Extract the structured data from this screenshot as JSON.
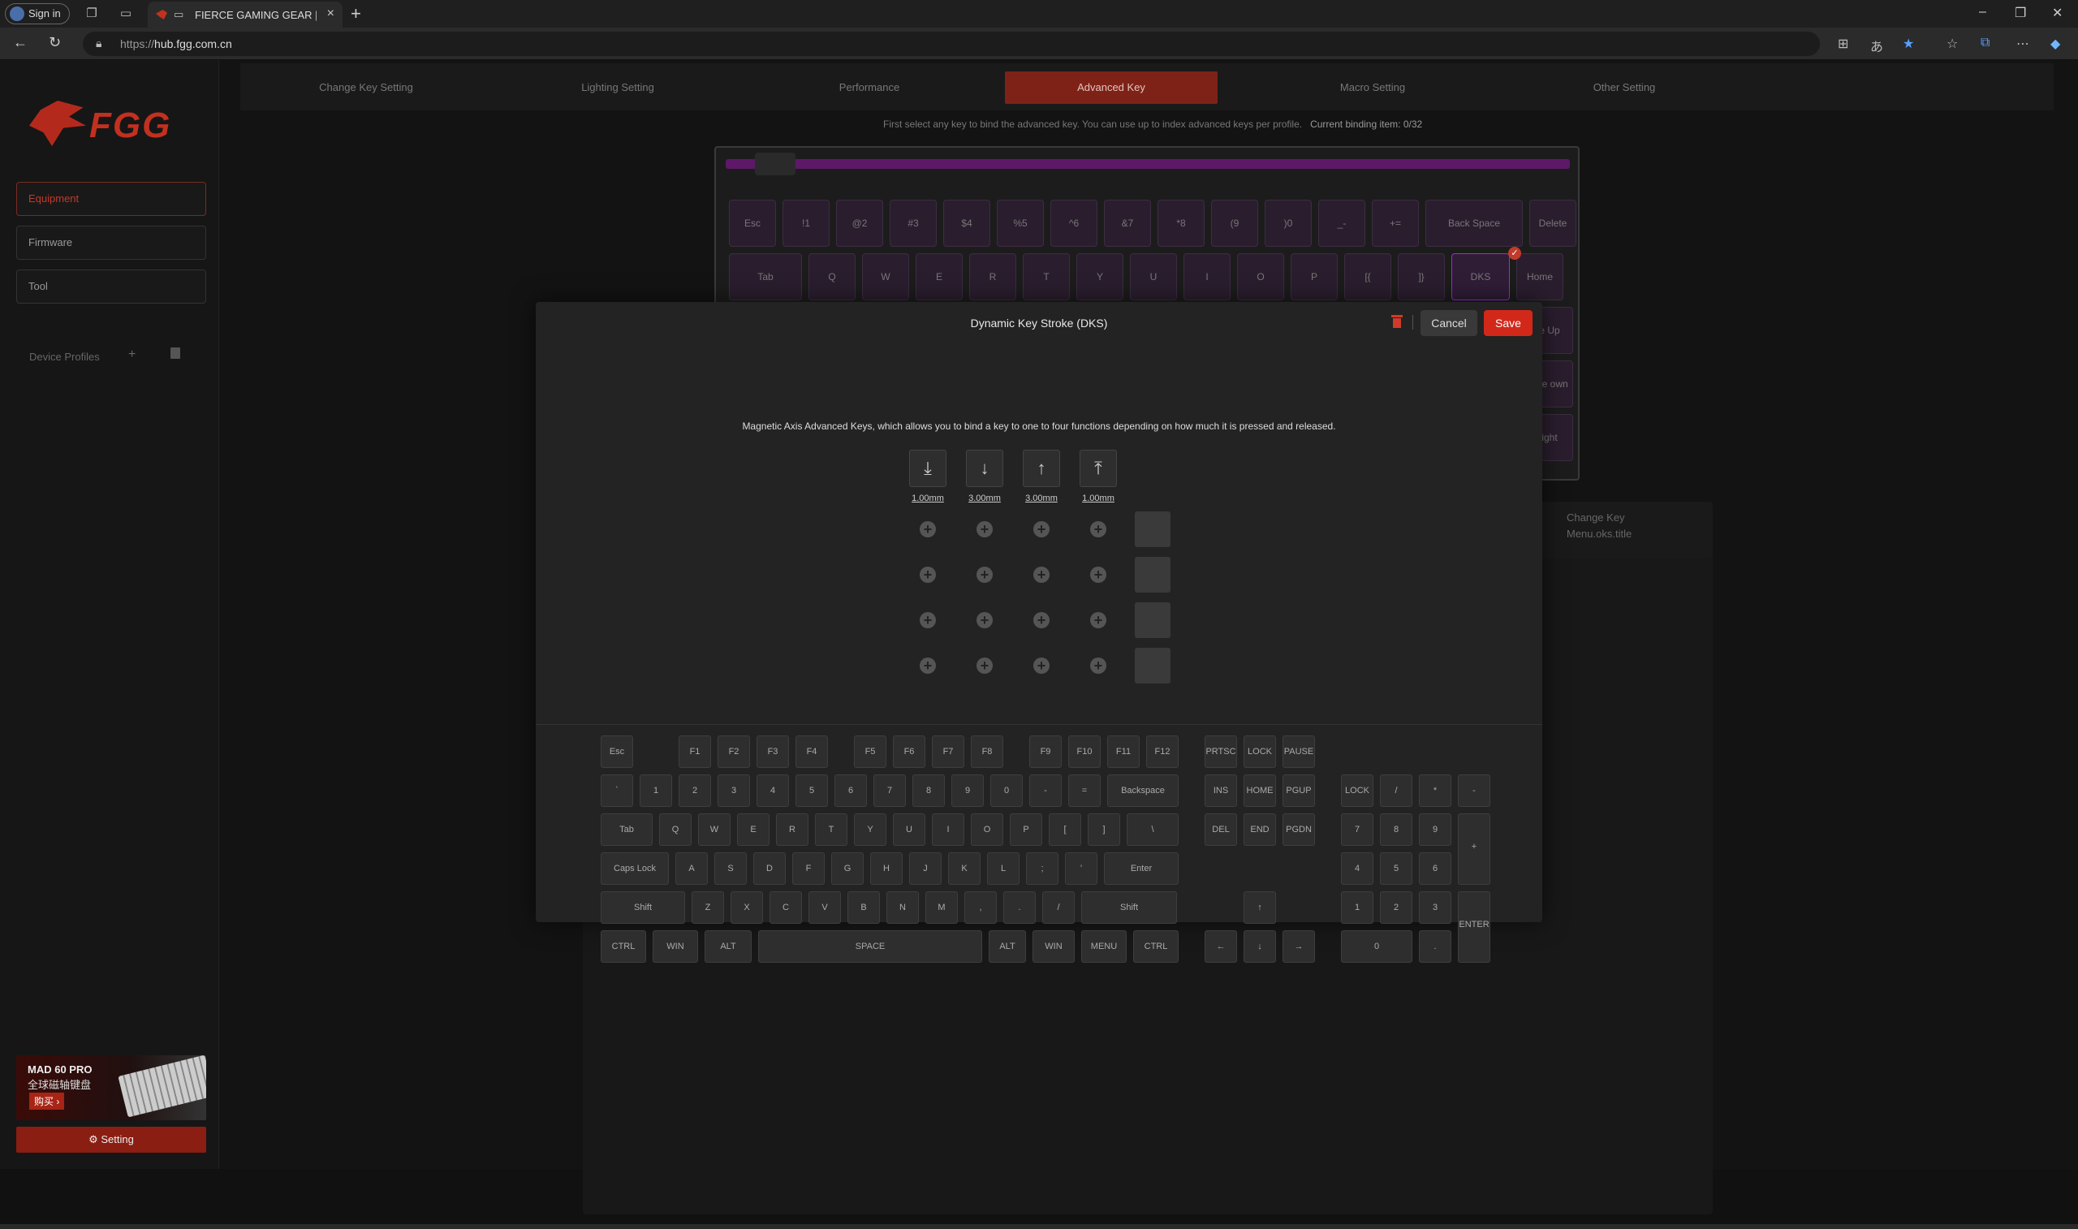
{
  "browser": {
    "signin_label": "Sign in",
    "tab_title": "FIERCE GAMING GEAR | MA",
    "url_prefix": "https://",
    "url_host": "hub.fgg.com.cn"
  },
  "sidebar": {
    "logo_text": "FGG",
    "items": [
      {
        "label": "Equipment"
      },
      {
        "label": "Firmware"
      },
      {
        "label": "Tool"
      }
    ],
    "profiles_label": "Device Profiles",
    "profiles_add": "+",
    "banner": {
      "line1": "MAD 60 PRO",
      "line2": "全球磁轴键盘",
      "cta": "购买 ›"
    },
    "setting_label": "Setting"
  },
  "topnav": [
    {
      "label": "Change Key Setting"
    },
    {
      "label": "Lighting Setting"
    },
    {
      "label": "Performance"
    },
    {
      "label": "Advanced Key"
    },
    {
      "label": "Macro Setting"
    },
    {
      "label": "Other Setting"
    }
  ],
  "hint": {
    "text": "First select any key to bind the advanced key. You can use up to index advanced keys per profile.",
    "binding": "Current binding item: 0/32"
  },
  "bg_keyboard": {
    "row1": [
      "Esc",
      "!1",
      "@2",
      "#3",
      "$4",
      "%5",
      "^6",
      "&7",
      "*8",
      "(9",
      ")0",
      "_-",
      "+=",
      "Back Space",
      "Delete"
    ],
    "row2": [
      "Tab",
      "Q",
      "W",
      "E",
      "R",
      "T",
      "Y",
      "U",
      "I",
      "O",
      "P",
      "[{",
      "]}",
      "DKS",
      "Home"
    ],
    "side": [
      "e Up",
      "age own",
      "ight"
    ]
  },
  "bg_panel": {
    "line1": "Change Key",
    "line2": "Menu.oks.title"
  },
  "modal": {
    "title": "Dynamic Key Stroke (DKS)",
    "cancel_label": "Cancel",
    "save_label": "Save",
    "description": "Magnetic Axis Advanced Keys, which allows you to bind a key to one to four functions depending on how much it is pressed and released.",
    "stages": [
      {
        "icon": "press-start-icon",
        "glyph": "⤓",
        "value": "1.00mm"
      },
      {
        "icon": "press-bottom-icon",
        "glyph": "↓",
        "value": "3.00mm"
      },
      {
        "icon": "release-start-icon",
        "glyph": "↑",
        "value": "3.00mm"
      },
      {
        "icon": "release-top-icon",
        "glyph": "⤒",
        "value": "1.00mm"
      }
    ],
    "plus_glyph": "+"
  },
  "virtual_keyboard": {
    "fn_row": [
      "Esc",
      "F1",
      "F2",
      "F3",
      "F4",
      "F5",
      "F6",
      "F7",
      "F8",
      "F9",
      "F10",
      "F11",
      "F12",
      "PRTSC",
      "LOCK",
      "PAUSE"
    ],
    "num_row": [
      "`",
      "1",
      "2",
      "3",
      "4",
      "5",
      "6",
      "7",
      "8",
      "9",
      "0",
      "-",
      "=",
      "Backspace",
      "INS",
      "HOME",
      "PGUP",
      "LOCK",
      "/",
      "*",
      "-"
    ],
    "q_row": [
      "Tab",
      "Q",
      "W",
      "E",
      "R",
      "T",
      "Y",
      "U",
      "I",
      "O",
      "P",
      "[",
      "]",
      "\\",
      "DEL",
      "END",
      "PGDN",
      "7",
      "8",
      "9",
      "+"
    ],
    "a_row": [
      "Caps Lock",
      "A",
      "S",
      "D",
      "F",
      "G",
      "H",
      "J",
      "K",
      "L",
      ";",
      "'",
      "Enter",
      "4",
      "5",
      "6"
    ],
    "z_row": [
      "Shift",
      "Z",
      "X",
      "C",
      "V",
      "B",
      "N",
      "M",
      ",",
      ".",
      "/",
      "Shift",
      "↑",
      "1",
      "2",
      "3",
      "ENTER"
    ],
    "space_row": [
      "CTRL",
      "WIN",
      "ALT",
      "SPACE",
      "ALT",
      "WIN",
      "MENU",
      "CTRL",
      "←",
      "↓",
      "→",
      "0",
      "."
    ]
  },
  "colors": {
    "accent": "#d2281a",
    "brand": "#c2301f",
    "tab_active": "#7e2218"
  }
}
